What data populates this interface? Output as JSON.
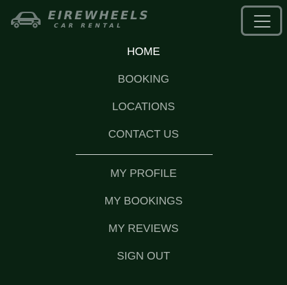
{
  "brand": {
    "name": "EIREWHEELS",
    "tagline": "CAR RENTAL",
    "logo_icon": "sports-car-icon"
  },
  "toggler": {
    "icon": "hamburger-menu-icon"
  },
  "nav": {
    "main_items": [
      {
        "label": "HOME",
        "active": true
      },
      {
        "label": "BOOKING",
        "active": false
      },
      {
        "label": "LOCATIONS",
        "active": false
      },
      {
        "label": "CONTACT US",
        "active": false
      }
    ],
    "account_items": [
      {
        "label": "MY PROFILE"
      },
      {
        "label": "MY BOOKINGS"
      },
      {
        "label": "MY REVIEWS"
      },
      {
        "label": "SIGN OUT"
      }
    ]
  },
  "colors": {
    "background": "#0a2212",
    "link": "#aab3ad",
    "active_link": "#ffffff",
    "brand_gray": "#7d8a85"
  }
}
